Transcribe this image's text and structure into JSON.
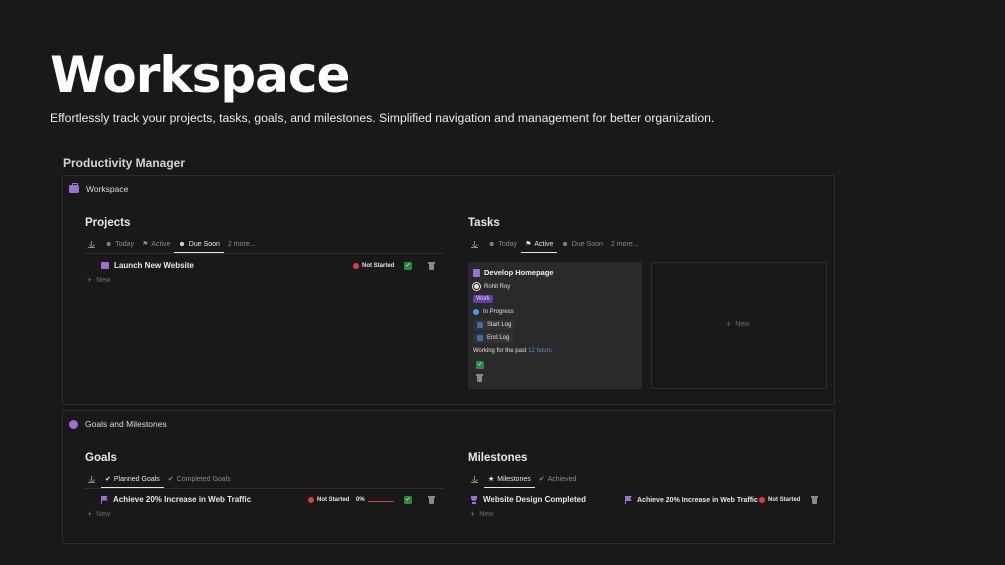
{
  "header": {
    "title": "Workspace",
    "subtitle": "Effortlessly track your projects, tasks, goals, and milestones. Simplified navigation and management for better organization."
  },
  "section_title": "Productivity Manager",
  "workspace_panel": {
    "label": "Workspace",
    "projects": {
      "title": "Projects",
      "tabs": [
        "Today",
        "Active",
        "Due Soon",
        "2 more..."
      ],
      "active_tab": "Due Soon",
      "rows": [
        {
          "name": "Launch New Website",
          "status": "Not Started"
        }
      ],
      "new_label": "New"
    },
    "tasks": {
      "title": "Tasks",
      "tabs": [
        "Today",
        "Active",
        "Due Soon",
        "2 more..."
      ],
      "active_tab": "Active",
      "card": {
        "title": "Develop Homepage",
        "assignee": "Rohit Roy",
        "tag": "Work",
        "status": "In Progress",
        "start_log": "Start Log",
        "end_log": "End Log",
        "working_prefix": "Working for the past",
        "working_hours": "12 hours"
      },
      "new_label": "New"
    }
  },
  "goals_panel": {
    "label": "Goals and Milestones",
    "goals": {
      "title": "Goals",
      "tabs": [
        "Planned Goals",
        "Completed Goals"
      ],
      "active_tab": "Planned Goals",
      "rows": [
        {
          "name": "Achieve 20% Increase in Web Traffic",
          "status": "Not Started",
          "progress": "0%"
        }
      ],
      "new_label": "New"
    },
    "milestones": {
      "title": "Milestones",
      "tabs": [
        "Milestones",
        "Achieved"
      ],
      "active_tab": "Milestones",
      "rows": [
        {
          "name": "Website Design Completed",
          "goal": "Achieve 20% Increase in Web Traffic",
          "status": "Not Started"
        }
      ],
      "new_label": "New"
    }
  },
  "colors": {
    "background": "#191919",
    "accent": "#9d6fd6",
    "status_red": "#e03e3e",
    "status_blue": "#4a9be8",
    "check_green": "#2b8a3e"
  }
}
